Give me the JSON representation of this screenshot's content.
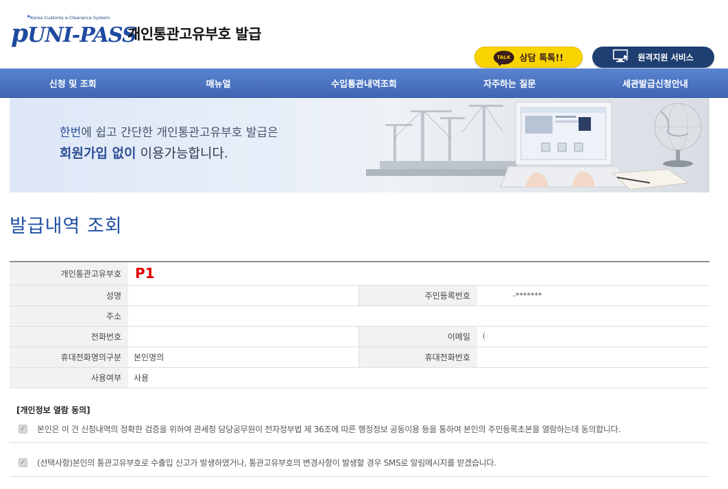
{
  "header": {
    "logo_tagline": "Korea Customs e-Clearance System",
    "logo_text": "UNI-PASS",
    "logo_letter": "p",
    "site_title": "개인통관고유부호 발급",
    "talk_icon_text": "TALK",
    "talk_button": "상담 톡톡!!",
    "remote_button": "원격지원 서비스"
  },
  "nav": {
    "items": [
      "신청 및 조회",
      "매뉴얼",
      "수입통관내역조회",
      "자주하는 질문",
      "세관발급신청안내"
    ]
  },
  "banner": {
    "line1_highlight": "한번",
    "line1_rest": "에 쉽고 간단한 개인통관고유부호 발급은",
    "line2_highlight": "회원가입 없이",
    "line2_rest": " 이용가능합니다."
  },
  "section": {
    "title": "발급내역 조회"
  },
  "info": {
    "customs_code_label": "개인통관고유부호",
    "customs_code_value": "P1",
    "name_label": "성명",
    "name_value": "",
    "rrn_label": "주민등록번호",
    "rrn_value": "-*******",
    "address_label": "주소",
    "address_value": "",
    "phone_label": "전화번호",
    "phone_value": "",
    "email_label": "이메일",
    "email_value": "(",
    "mobile_owner_label": "휴대전화명의구분",
    "mobile_owner_value": "본인명의",
    "mobile_label": "휴대전화번호",
    "mobile_value": "",
    "usage_label": "사용여부",
    "usage_value": "사용"
  },
  "consent": {
    "title": "[개인정보 열람 동의]",
    "item1": "본인은 이 건 신청내역의 정확한 검증을 위하여 관세청 담당공무원이 전자정부법 제 36조에 따른 행정정보 공동이용 등을 통하여 본인의 주민등록초본을 열람하는데 동의합니다.",
    "item1_checked": true,
    "item2": "(선택사항)본인의 통관고유부호로 수출입 신고가 발생하였거나, 통관고유부호의 변경사항이 발생할 경우 SMS로 알림메시지를 받겠습니다.",
    "item2_checked": true
  },
  "colors": {
    "nav": "#4a72c0",
    "title_blue": "#1e4fa3",
    "code_red": "#e00000",
    "talk_yellow": "#f9d400",
    "remote_navy": "#1f3f72"
  }
}
